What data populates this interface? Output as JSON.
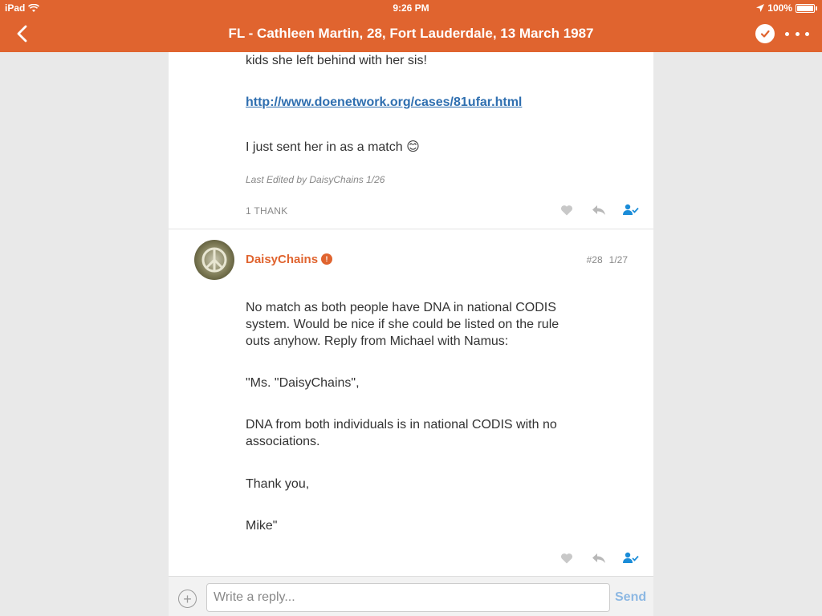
{
  "status_bar": {
    "device": "iPad",
    "time": "9:26 PM",
    "battery": "100%"
  },
  "nav": {
    "title": "FL - Cathleen Martin, 28, Fort Lauderdale, 13 March 1987"
  },
  "previous_post": {
    "line_partial": "kids she left behind with her sis!",
    "link": "http://www.doenetwork.org/cases/81ufar.html",
    "sent_text": "I just sent her in as a match 😊",
    "edited": "Last Edited by DaisyChains 1/26",
    "thanks": "1 THANK"
  },
  "post": {
    "author": "DaisyChains",
    "number": "#28",
    "date": "1/27",
    "paragraphs": [
      "No match as both people have DNA in national CODIS system. Would be nice if she could be listed on the rule outs anyhow. Reply from Michael with Namus:",
      "\"Ms. \"DaisyChains\",",
      "DNA from both individuals is in national CODIS with no associations.",
      "Thank you,",
      "Mike\""
    ]
  },
  "reply": {
    "placeholder": "Write a reply...",
    "send": "Send"
  },
  "colors": {
    "brand": "#e0642f",
    "link": "#2f6fb0",
    "accent_blue": "#1a8cd8"
  }
}
